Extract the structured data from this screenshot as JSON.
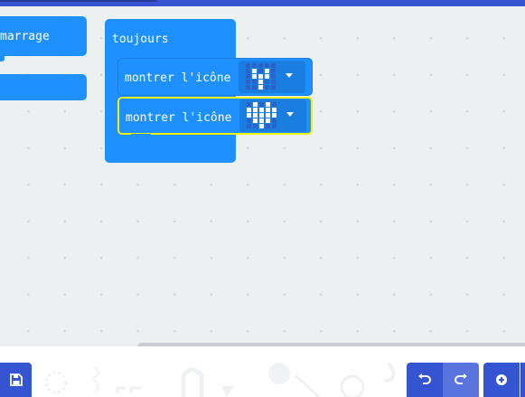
{
  "start_block": {
    "label": "marrage"
  },
  "forever_block": {
    "label": "toujours"
  },
  "show_icon_blocks": [
    {
      "label": "montrer l'icône",
      "icon": "small-heart-icon"
    },
    {
      "label": "montrer l'icône",
      "icon": "heart-icon"
    }
  ],
  "toolbar": {
    "save_icon": "save-icon",
    "undo_icon": "undo-icon",
    "redo_icon": "redo-icon",
    "zoom_icon": "zoom-in-icon"
  },
  "colors": {
    "block_blue": "#1e90ff",
    "selection_yellow": "#f0f20a",
    "toolbar_blue": "#3454d1",
    "workspace": "#ecf0f1"
  }
}
